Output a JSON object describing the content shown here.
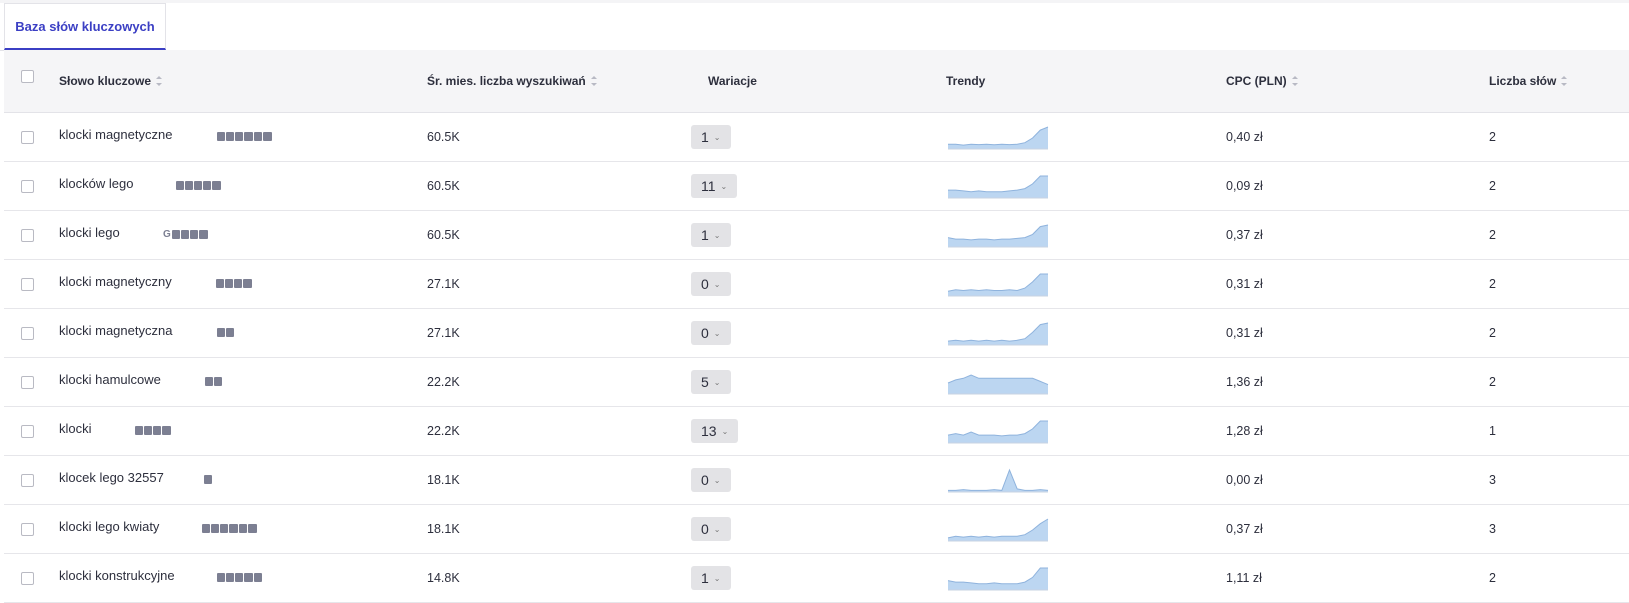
{
  "tabs": [
    {
      "label": "Baza słów kluczowych",
      "active": true
    }
  ],
  "columns": {
    "keyword": "Słowo kluczowe",
    "volume": "Śr. mies. liczba wyszukiwań",
    "variations": "Wariacje",
    "trends": "Trendy",
    "cpc": "CPC (PLN)",
    "words": "Liczba słów"
  },
  "colors": {
    "accent": "#3b3fc4",
    "trend_fill": "#bcd6f1",
    "trend_line": "#8fb3dd"
  },
  "rows": [
    {
      "keyword": "klocki magnetyczne",
      "features": [
        "image-pack-icon",
        "map-icon",
        "shopping-icon",
        "ads-icon",
        "video-icon",
        "knowledge-icon"
      ],
      "volume": "60.5K",
      "variations": "1",
      "trend": [
        3,
        3,
        2.5,
        3,
        2.8,
        3,
        2.7,
        3,
        2.8,
        3,
        4,
        7,
        12,
        14
      ],
      "cpc": "0,40 zł",
      "words": "2"
    },
    {
      "keyword": "klocków lego",
      "features": [
        "image-pack-icon",
        "map-icon",
        "shopping-icon",
        "video-icon",
        "knowledge-icon"
      ],
      "volume": "60.5K",
      "variations": "11",
      "trend": [
        5,
        5,
        4.5,
        4,
        4.5,
        4,
        4,
        4,
        4.5,
        5,
        6,
        9,
        14,
        14
      ],
      "cpc": "0,09 zł",
      "words": "2"
    },
    {
      "keyword": "klocki lego",
      "features": [
        "google-icon",
        "image-pack-icon",
        "map-icon",
        "shopping-icon",
        "knowledge-icon"
      ],
      "volume": "60.5K",
      "variations": "1",
      "trend": [
        6,
        5,
        5,
        4.5,
        5,
        5,
        4.5,
        5,
        5,
        5.5,
        6,
        8,
        13,
        14
      ],
      "cpc": "0,37 zł",
      "words": "2"
    },
    {
      "keyword": "klocki magnetyczny",
      "features": [
        "image-pack-icon",
        "map-icon",
        "shopping-icon",
        "knowledge-icon"
      ],
      "volume": "27.1K",
      "variations": "0",
      "trend": [
        3,
        4,
        3.5,
        4,
        3.5,
        4,
        3.5,
        3.5,
        4,
        3.5,
        5,
        9,
        14,
        14
      ],
      "cpc": "0,31 zł",
      "words": "2"
    },
    {
      "keyword": "klocki magnetyczna",
      "features": [
        "image-pack-icon",
        "shopping-icon"
      ],
      "volume": "27.1K",
      "variations": "0",
      "trend": [
        2.5,
        3,
        2.5,
        3,
        2.5,
        3,
        2.5,
        3,
        2.5,
        3,
        4,
        8,
        13,
        14
      ],
      "cpc": "0,31 zł",
      "words": "2"
    },
    {
      "keyword": "klocki hamulcowe",
      "features": [
        "image-pack-icon",
        "map-icon"
      ],
      "volume": "22.2K",
      "variations": "5",
      "trend": [
        7,
        9,
        10,
        12,
        10,
        10,
        10,
        10,
        10,
        10,
        10,
        10,
        8,
        6
      ],
      "cpc": "1,36 zł",
      "words": "2"
    },
    {
      "keyword": "klocki",
      "features": [
        "image-pack-icon",
        "map-icon",
        "shopping-icon",
        "knowledge-icon"
      ],
      "volume": "22.2K",
      "variations": "13",
      "trend": [
        5,
        6,
        5,
        7,
        5,
        5,
        5,
        4.5,
        5,
        5,
        6,
        9,
        14,
        14
      ],
      "cpc": "1,28 zł",
      "words": "1"
    },
    {
      "keyword": "klocek lego 32557",
      "features": [
        "reviews-icon"
      ],
      "volume": "18.1K",
      "variations": "0",
      "trend": [
        1,
        1,
        1.5,
        1,
        1,
        1,
        1.5,
        1,
        14,
        2,
        1,
        1,
        1.5,
        1
      ],
      "cpc": "0,00 zł",
      "words": "3"
    },
    {
      "keyword": "klocki lego kwiaty",
      "features": [
        "image-pack-icon",
        "map-icon",
        "shopping-icon",
        "ads-icon",
        "video-icon",
        "knowledge-icon"
      ],
      "volume": "18.1K",
      "variations": "0",
      "trend": [
        2,
        3,
        2.5,
        3,
        2.5,
        3,
        2.5,
        3,
        3,
        3,
        4,
        7,
        11,
        14
      ],
      "cpc": "0,37 zł",
      "words": "3"
    },
    {
      "keyword": "klocki konstrukcyjne",
      "features": [
        "image-pack-icon",
        "map-icon",
        "shopping-icon",
        "ads-icon",
        "video-icon"
      ],
      "volume": "14.8K",
      "variations": "1",
      "trend": [
        6,
        5,
        5,
        4.5,
        4,
        4,
        4.5,
        4,
        4,
        4,
        5,
        8,
        14,
        14
      ],
      "cpc": "1,11 zł",
      "words": "2"
    }
  ]
}
